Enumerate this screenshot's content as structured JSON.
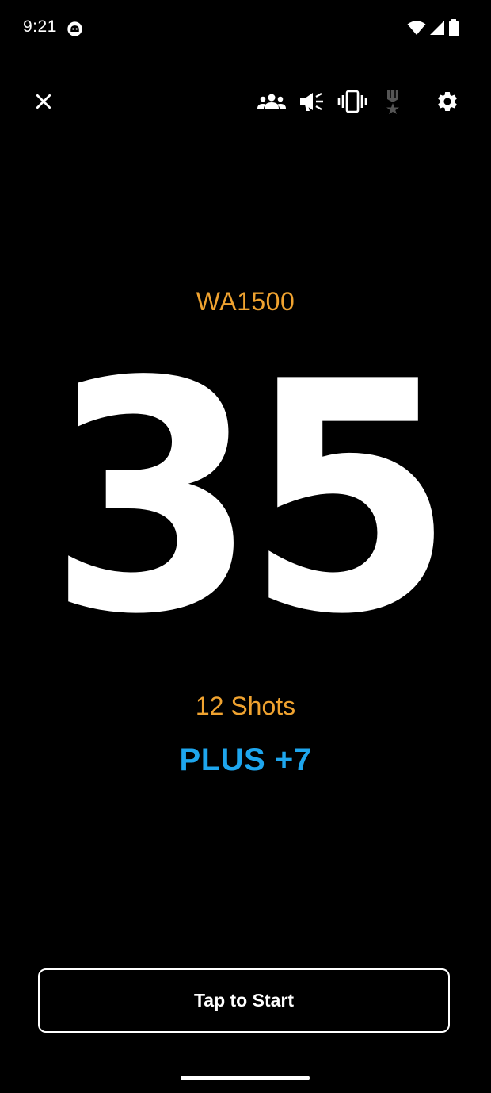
{
  "status_bar": {
    "time": "9:21",
    "icons": [
      "notification-app-icon",
      "wifi-icon",
      "cell-signal-icon",
      "battery-icon"
    ]
  },
  "toolbar": {
    "icons": [
      "close-icon",
      "group-icon",
      "announce-icon",
      "vibrate-icon",
      "medal-icon",
      "settings-icon"
    ]
  },
  "main": {
    "profile_name": "WA1500",
    "score": "35",
    "shots": "12 Shots",
    "plus": "PLUS +7"
  },
  "footer": {
    "start_label": "Tap to Start"
  },
  "colors": {
    "background": "#000000",
    "accent_orange": "#f0a330",
    "accent_blue": "#1ea6ee",
    "text": "#ffffff"
  }
}
